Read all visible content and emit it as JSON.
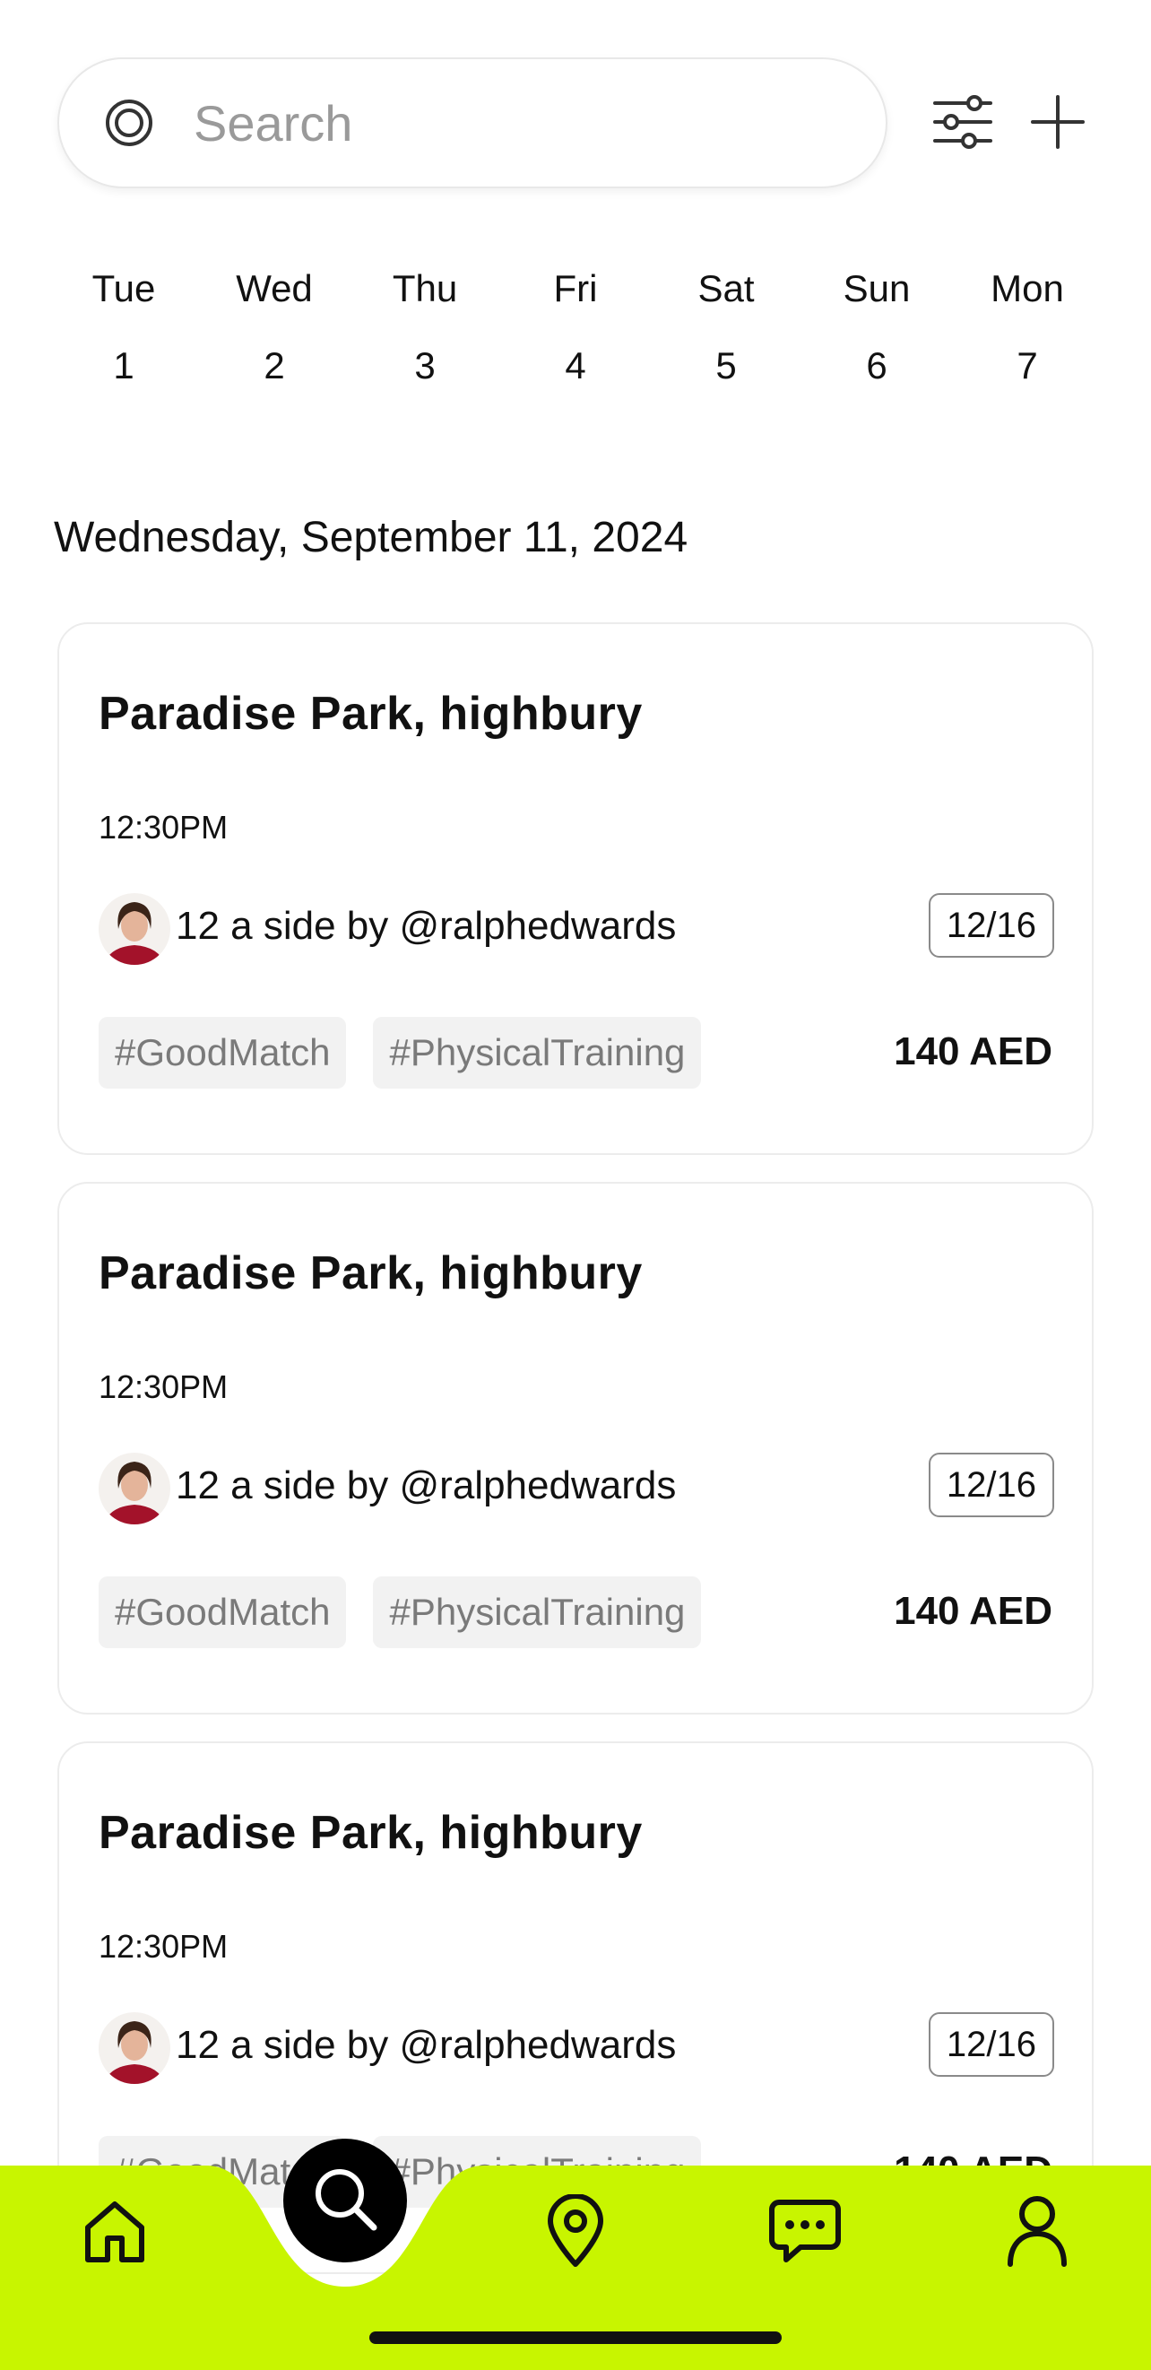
{
  "search": {
    "placeholder": "Search"
  },
  "toolbar": {
    "filter_icon": "sliders-icon",
    "add_icon": "plus-icon"
  },
  "week": [
    {
      "name": "Tue",
      "num": "1"
    },
    {
      "name": "Wed",
      "num": "2"
    },
    {
      "name": "Thu",
      "num": "3"
    },
    {
      "name": "Fri",
      "num": "4"
    },
    {
      "name": "Sat",
      "num": "5"
    },
    {
      "name": "Sun",
      "num": "6"
    },
    {
      "name": "Mon",
      "num": "7"
    }
  ],
  "date_heading": "Wednesday, September 11, 2024",
  "events": [
    {
      "title": "Paradise Park, highbury",
      "time": "12:30PM",
      "organizer": "12 a side by @ralphedwards",
      "capacity": "12/16",
      "tags": [
        "#GoodMatch",
        "#PhysicalTraining"
      ],
      "price": "140 AED"
    },
    {
      "title": "Paradise Park, highbury",
      "time": "12:30PM",
      "organizer": "12 a side by @ralphedwards",
      "capacity": "12/16",
      "tags": [
        "#GoodMatch",
        "#PhysicalTraining"
      ],
      "price": "140 AED"
    },
    {
      "title": "Paradise Park, highbury",
      "time": "12:30PM",
      "organizer": "12 a side by @ralphedwards",
      "capacity": "12/16",
      "tags": [
        "#GoodMatch",
        "#PhysicalTraining"
      ],
      "price": "140 AED"
    }
  ],
  "nav": {
    "items": [
      "home-icon",
      "search-icon",
      "location-pin-icon",
      "chat-icon",
      "profile-icon"
    ],
    "active": "search-icon"
  },
  "colors": {
    "accent": "#C8F500",
    "text": "#111111",
    "muted": "#7A7A7A",
    "tag_bg": "#F2F2F2"
  }
}
